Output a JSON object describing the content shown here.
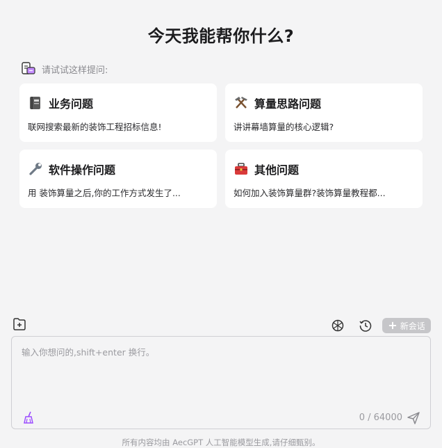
{
  "header": {
    "title": "今天我能帮你什么?"
  },
  "hint": {
    "text": "请试试这样提问:"
  },
  "cards": [
    {
      "icon": "ledger-book-icon",
      "title": "业务问题",
      "desc": "联网搜索最新的装饰工程招标信息!"
    },
    {
      "icon": "hammer-pick-icon",
      "title": "算量思路问题",
      "desc": "讲讲幕墙算量的核心逻辑?"
    },
    {
      "icon": "wrench-icon",
      "title": "软件操作问题",
      "desc": "用 装饰算量之后,你的工作方式发生了..."
    },
    {
      "icon": "toolbox-icon",
      "title": "其他问题",
      "desc": "如何加入装饰算量群?装饰算量教程都..."
    }
  ],
  "toolbar": {
    "new_chat_label": "新会话"
  },
  "input": {
    "placeholder": "输入你想问的,shift+enter 换行。",
    "value": "",
    "counter": "0 / 64000"
  },
  "footer": {
    "text": "所有内容均由 AecGPT 人工智能模型生成,请仔细甄别。"
  },
  "colors": {
    "accent_purple": "#9b4dff",
    "button_gray": "#c6c6c9",
    "background": "#f4f4f5"
  }
}
